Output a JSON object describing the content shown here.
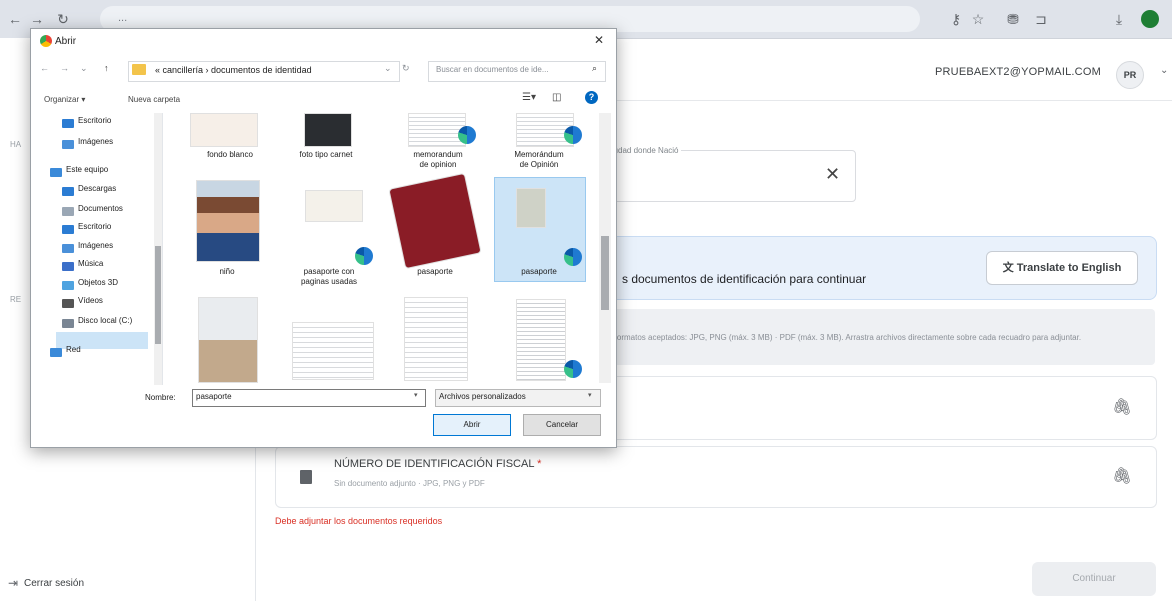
{
  "browser": {
    "url": "...",
    "icons": [
      "back-icon",
      "forward-icon",
      "reload-icon",
      "key-icon",
      "star-icon",
      "extension-icon",
      "puzzle-icon",
      "download-icon"
    ]
  },
  "page": {
    "user_email": "PRUEBAEXT2@YOPMAIL.COM",
    "avatar_initials": "PR",
    "field_label": "Ciudad donde Nació",
    "banner_text": "s documentos de identificación para continuar",
    "translate_button": "Translate to English",
    "info_text": "Formatos aceptados: JPG, PNG (máx. 3 MB) · PDF (máx. 3 MB). Arrastra archivos directamente sobre cada recuadro para adjuntar.",
    "doc_title": "NÚMERO DE IDENTIFICACIÓN FISCAL",
    "doc_required_mark": "*",
    "doc_subtitle": "Sin documento adjunto · JPG, PNG y PDF",
    "error_text": "Debe adjuntar los documentos requeridos",
    "continue_button": "Continuar",
    "logout": "Cerrar sesión",
    "side_marks": [
      "HA",
      "RE"
    ]
  },
  "dialog": {
    "title": "Abrir",
    "breadcrumb": "« cancillería › documentos de identidad",
    "search_placeholder": "Buscar en documentos de ide...",
    "organize": "Organizar ▾",
    "new_folder": "Nueva carpeta",
    "nav_items": [
      {
        "label": "Escritorio",
        "color": "#2b7cd3"
      },
      {
        "label": "Imágenes",
        "color": "#4a90d9"
      },
      {
        "label": "Este equipo",
        "color": "#3b8ad9"
      },
      {
        "label": "Descargas",
        "color": "#2b7cd3"
      },
      {
        "label": "Documentos",
        "color": "#9aa7b5"
      },
      {
        "label": "Escritorio",
        "color": "#2b7cd3"
      },
      {
        "label": "Imágenes",
        "color": "#4a90d9"
      },
      {
        "label": "Música",
        "color": "#3b6fc9"
      },
      {
        "label": "Objetos 3D",
        "color": "#4fa3e0"
      },
      {
        "label": "Vídeos",
        "color": "#555"
      },
      {
        "label": "Disco local (C:)",
        "color": "#7a8694"
      },
      {
        "label": "Red",
        "color": "#3b8ad9"
      }
    ],
    "files": [
      {
        "label": "fondo blanco",
        "label2": ""
      },
      {
        "label": "foto tipo carnet",
        "label2": ""
      },
      {
        "label": "memorandum",
        "label2": "de opinion"
      },
      {
        "label": "Memorándum",
        "label2": "de Opinión"
      },
      {
        "label": "niño",
        "label2": ""
      },
      {
        "label": "pasaporte con",
        "label2": "paginas usadas"
      },
      {
        "label": "pasaporte",
        "label2": ""
      },
      {
        "label": "pasaporte",
        "label2": ""
      }
    ],
    "name_label": "Nombre:",
    "name_value": "pasaporte",
    "filter_value": "Archivos personalizados",
    "open_button": "Abrir",
    "cancel_button": "Cancelar"
  }
}
